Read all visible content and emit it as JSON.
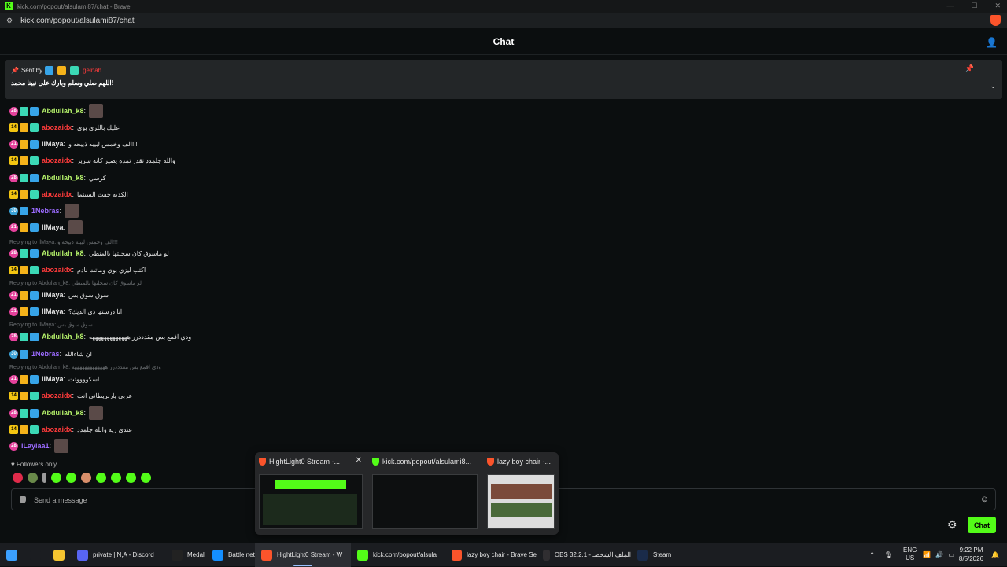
{
  "window": {
    "title": "kick.com/popout/alsulami87/chat - Brave",
    "url": "kick.com/popout/alsulami87/chat"
  },
  "chat": {
    "title": "Chat",
    "pinned": {
      "sent_by_label": "Sent by",
      "sender": "gelnah",
      "message": "اللهم صلي وسلم وبارك على نبينا محمد!"
    },
    "messages": [
      {
        "sub": "28",
        "subClass": "b-sub",
        "badges": [
          "b-og",
          "b-vip"
        ],
        "user": "Abdullah_k8",
        "color": "#b6f36b",
        "text": "",
        "emote": true
      },
      {
        "sub": "14",
        "subClass": "b-sub14",
        "badges": [
          "b-crown",
          "b-og"
        ],
        "user": "abozaidx",
        "color": "#ff3b3b",
        "text": "عليك باللزي بوي",
        "emote": false
      },
      {
        "sub": "21",
        "subClass": "b-sub",
        "badges": [
          "b-crown",
          "b-vip"
        ],
        "user": "llMaya",
        "color": "#e6e6e6",
        "text": "الف وخمس لبيبه ذبيحه و!!!",
        "emote": false
      },
      {
        "sub": "14",
        "subClass": "b-sub14",
        "badges": [
          "b-crown",
          "b-og"
        ],
        "user": "abozaidx",
        "color": "#ff3b3b",
        "text": "والله جلمدد تقدر تمده يصير كانه سرير",
        "emote": false
      },
      {
        "sub": "28",
        "subClass": "b-sub",
        "badges": [
          "b-og",
          "b-vip"
        ],
        "user": "Abdullah_k8",
        "color": "#b6f36b",
        "text": "كرسي",
        "emote": false
      },
      {
        "sub": "14",
        "subClass": "b-sub14",
        "badges": [
          "b-crown",
          "b-og"
        ],
        "user": "abozaidx",
        "color": "#ff3b3b",
        "text": "الكذبه حقت السينما",
        "emote": false
      },
      {
        "sub": "30",
        "subClass": "b-sub30",
        "badges": [
          "b-vip"
        ],
        "user": "1Nebras",
        "color": "#9b6bff",
        "text": "",
        "emote": true
      },
      {
        "sub": "21",
        "subClass": "b-sub",
        "badges": [
          "b-crown",
          "b-vip"
        ],
        "user": "llMaya",
        "color": "#e6e6e6",
        "text": "",
        "emote": true
      },
      {
        "reply": "Replying to llMaya: الف وخمس لبيبه ذبيحه و!!!"
      },
      {
        "sub": "28",
        "subClass": "b-sub",
        "badges": [
          "b-og",
          "b-vip"
        ],
        "user": "Abdullah_k8",
        "color": "#b6f36b",
        "text": "لو ماسوق كان سجلتها بالمنطي",
        "emote": false
      },
      {
        "sub": "14",
        "subClass": "b-sub14",
        "badges": [
          "b-crown",
          "b-og"
        ],
        "user": "abozaidx",
        "color": "#ff3b3b",
        "text": "اكتب ليزي بوي وماتت نادم",
        "emote": false
      },
      {
        "reply": "Replying to Abdullah_k8: لو ماسوق كان سجلتها بالمنطي"
      },
      {
        "sub": "21",
        "subClass": "b-sub",
        "badges": [
          "b-crown",
          "b-vip"
        ],
        "user": "llMaya",
        "color": "#e6e6e6",
        "text": "سوق سوق بس",
        "emote": false
      },
      {
        "sub": "21",
        "subClass": "b-sub",
        "badges": [
          "b-crown",
          "b-vip"
        ],
        "user": "llMaya",
        "color": "#e6e6e6",
        "text": "انا درستها ذي الديك؟",
        "emote": false
      },
      {
        "reply": "Replying to llMaya: سوق سوق بس"
      },
      {
        "sub": "28",
        "subClass": "b-sub",
        "badges": [
          "b-og",
          "b-vip"
        ],
        "user": "Abdullah_k8",
        "color": "#b6f36b",
        "text": "ودي اقمع بس مقدددرر هههههههههههههه",
        "emote": false
      },
      {
        "sub": "30",
        "subClass": "b-sub30",
        "badges": [
          "b-vip"
        ],
        "user": "1Nebras",
        "color": "#9b6bff",
        "text": "ان شاءالله",
        "emote": false
      },
      {
        "reply": "Replying to Abdullah_k8: ودي اقمع بس مقدددرر هههههههههههههه"
      },
      {
        "sub": "21",
        "subClass": "b-sub",
        "badges": [
          "b-crown",
          "b-vip"
        ],
        "user": "llMaya",
        "color": "#e6e6e6",
        "text": "اسكووووتت",
        "emote": false
      },
      {
        "sub": "14",
        "subClass": "b-sub14",
        "badges": [
          "b-crown",
          "b-og"
        ],
        "user": "abozaidx",
        "color": "#ff3b3b",
        "text": "عربي ياربريطاني انت",
        "emote": false
      },
      {
        "sub": "28",
        "subClass": "b-sub",
        "badges": [
          "b-og",
          "b-vip"
        ],
        "user": "Abdullah_k8",
        "color": "#b6f36b",
        "text": "",
        "emote": true
      },
      {
        "sub": "14",
        "subClass": "b-sub14",
        "badges": [
          "b-crown",
          "b-og"
        ],
        "user": "abozaidx",
        "color": "#ff3b3b",
        "text": "عندي زيه والله جلمدد",
        "emote": false
      },
      {
        "sub": "28",
        "subClass": "b-sub",
        "badges": [],
        "user": "lLaylaa1",
        "color": "#9b6bff",
        "text": "",
        "emote": true
      }
    ],
    "followers_only": "Followers only",
    "input_placeholder": "Send a message",
    "send_label": "Chat"
  },
  "thumbnails": [
    {
      "title": "HightLight0 Stream -...",
      "icon_color": "#fb542b",
      "close": "✕"
    },
    {
      "title": "kick.com/popout/alsulami8...",
      "icon_color": "#53fc18",
      "close": ""
    },
    {
      "title": "lazy boy chair -...",
      "icon_color": "#fb542b",
      "close": ""
    }
  ],
  "taskbar": {
    "items": [
      {
        "label": "",
        "color": "#3ba0ff",
        "name": "start-button"
      },
      {
        "label": "",
        "color": "#1b1d21",
        "name": "search-taskbar-button"
      },
      {
        "label": "",
        "color": "#f4c430",
        "name": "file-explorer-button"
      },
      {
        "label": "private | N,A - Discord",
        "color": "#5865f2",
        "name": "taskbar-discord"
      },
      {
        "label": "Medal",
        "color": "#222",
        "name": "taskbar-medal"
      },
      {
        "label": "Battle.net",
        "color": "#148eff",
        "name": "taskbar-battlenet"
      },
      {
        "label": "HightLight0 Stream - W",
        "color": "#fb542b",
        "name": "taskbar-brave-stream",
        "active": true
      },
      {
        "label": "kick.com/popout/alsula",
        "color": "#53fc18",
        "name": "taskbar-kick"
      },
      {
        "label": "lazy boy chair - Brave Se",
        "color": "#fb542b",
        "name": "taskbar-brave-chair"
      },
      {
        "label": "OBS 32.2.1 - الملف الشخصـ",
        "color": "#302e31",
        "name": "taskbar-obs"
      },
      {
        "label": "Steam",
        "color": "#1a2b4a",
        "name": "taskbar-steam"
      }
    ],
    "lang_top": "ENG",
    "lang_bottom": "US",
    "time": "9:22 PM",
    "date": "8/5/2026"
  }
}
